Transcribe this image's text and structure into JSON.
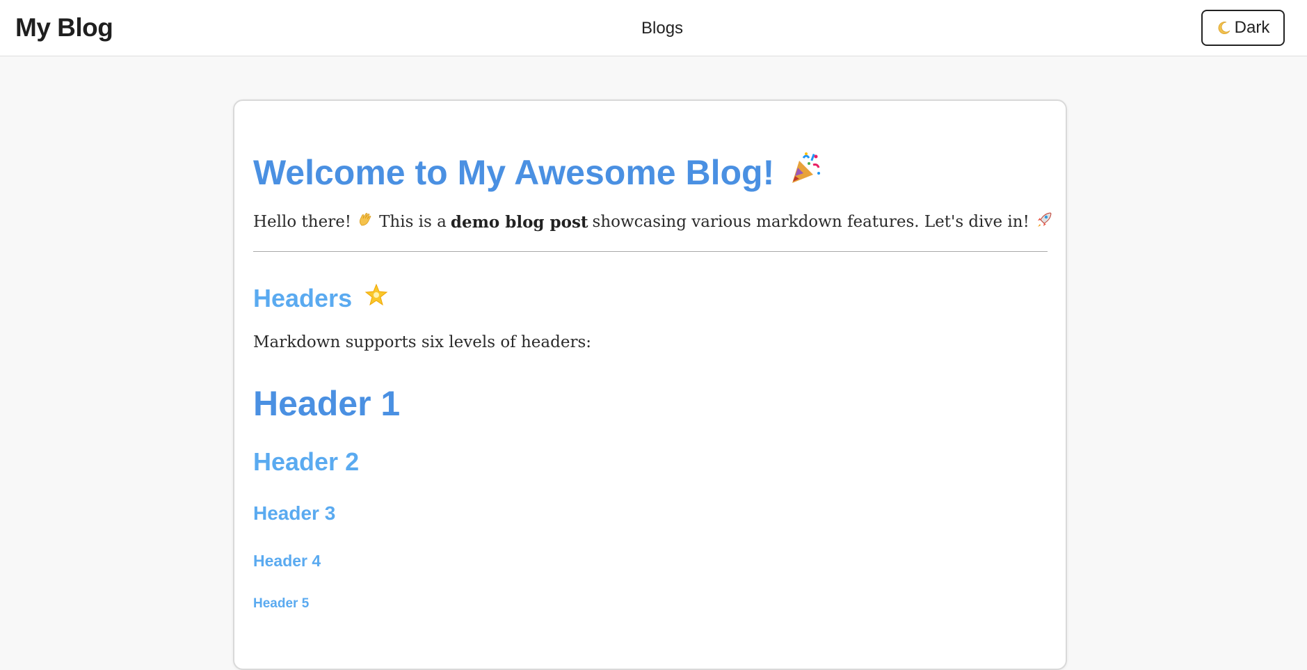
{
  "header": {
    "brand": "My Blog",
    "nav_link": "Blogs",
    "theme_button_label": "Dark",
    "theme_button_icon": "moon-icon"
  },
  "article": {
    "title": "Welcome to My Awesome Blog!",
    "title_icon": "party-popper-icon",
    "intro": {
      "before": "Hello there!",
      "wave_icon": "waving-hand-icon",
      "middle": "This is a",
      "bold": "demo blog post",
      "after": "showcasing various markdown features. Let's dive in!",
      "end_icon": "rocket-icon"
    },
    "section_heading": "Headers",
    "section_icon": "glowing-star-icon",
    "section_text": "Markdown supports six levels of headers:",
    "headers": {
      "h1": "Header 1",
      "h2": "Header 2",
      "h3": "Header 3",
      "h4": "Header 4",
      "h5": "Header 5"
    }
  },
  "colors": {
    "h1": "#4a90e2",
    "h2_and_below": "#5aaaf0",
    "background": "#f8f8f8",
    "card": "#ffffff"
  }
}
